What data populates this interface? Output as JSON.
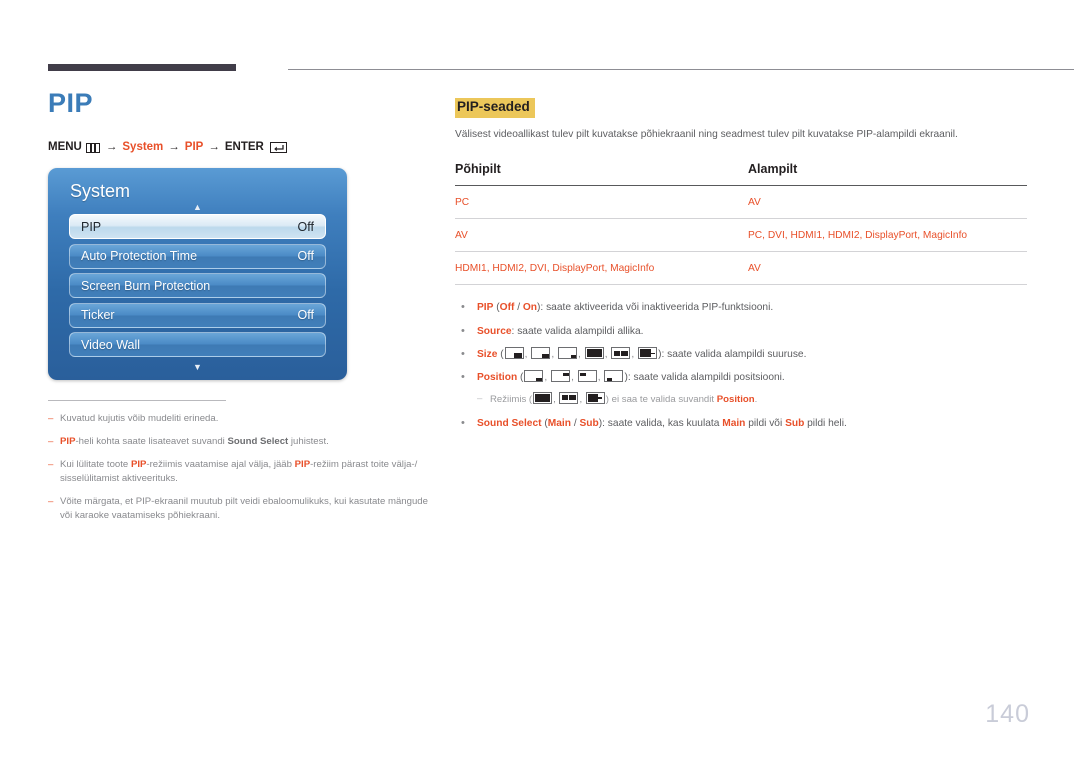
{
  "document": {
    "page_number": "140",
    "language": "et"
  },
  "left": {
    "title": "PIP",
    "menu_path": {
      "menu_label": "MENU",
      "menu_icon": "menu-bars-icon",
      "arrow": "→",
      "system_label": "System",
      "pip_label": "PIP",
      "enter_label": "ENTER",
      "enter_icon": "enter-return-icon"
    },
    "osd": {
      "title": "System",
      "scroll_up_icon": "caret-up-icon",
      "scroll_down_icon": "caret-down-icon",
      "rows": [
        {
          "label": "PIP",
          "value": "Off",
          "selected": true
        },
        {
          "label": "Auto Protection Time",
          "value": "Off",
          "selected": false
        },
        {
          "label": "Screen Burn Protection",
          "value": "",
          "selected": false
        },
        {
          "label": "Ticker",
          "value": "Off",
          "selected": false
        },
        {
          "label": "Video Wall",
          "value": "",
          "selected": false
        }
      ]
    },
    "notes": [
      {
        "dash": "–",
        "html": "Kuvatud kujutis võib mudeliti erineda."
      },
      {
        "dash": "–",
        "html": "<b>PIP</b>-heli kohta saate lisateavet suvandi <span class=\"gray-b\">Sound Select</span> juhistest."
      },
      {
        "dash": "–",
        "html": "Kui lülitate toote <b>PIP</b>-režiimis vaatamise ajal välja, jääb <b>PIP</b>-režiim pärast toite välja-/ sisselülitamist aktiveerituks."
      },
      {
        "dash": "–",
        "html": "Võite märgata, et PIP-ekraanil muutub pilt veidi ebaloomulikuks, kui kasutate mängude või karaoke vaatamiseks põhiekraani."
      }
    ]
  },
  "right": {
    "section_heading": "PIP-seaded",
    "section_description": "Välisest videoallikast tulev pilt kuvatakse põhiekraanil ning seadmest tulev pilt kuvatakse PIP-alampildi ekraanil.",
    "table": {
      "headers": [
        "Põhipilt",
        "Alampilt"
      ],
      "rows": [
        [
          "PC",
          "AV"
        ],
        [
          "AV",
          "PC, DVI, HDMI1, HDMI2, DisplayPort, MagicInfo"
        ],
        [
          "HDMI1, HDMI2, DVI, DisplayPort, MagicInfo",
          "AV"
        ]
      ]
    },
    "bullets": [
      {
        "bullet": "•",
        "html": "<b>PIP</b> (<b>Off</b> / <b>On</b>): saate aktiveerida või inaktiveerida PIP-funktsiooni."
      },
      {
        "bullet": "•",
        "html": "<b>Source</b>: saate valida alampildi allika."
      },
      {
        "bullet": "•",
        "html": "<b>Size</b> (@ICONS_SIZE@): saate valida alampildi suuruse."
      },
      {
        "bullet": "•",
        "html": "<b>Position</b> (@ICONS_POSITION@): saate valida alampildi positsiooni."
      },
      {
        "bullet": "•",
        "html": "<b>Sound Select</b> (<b>Main</b> / <b>Sub</b>): saate valida, kas kuulata <b>Main</b> pildi või <b>Sub</b> pildi heli."
      }
    ],
    "subnote": {
      "dash": "–",
      "html": "Režiimis (@ICONS_SUBNOTE@) ei saa te valida suvandit <b>Position</b>."
    },
    "icon_sets": {
      "size": [
        "pip-size-large-bottom-right-icon",
        "pip-size-medium-bottom-right-icon",
        "pip-size-small-bottom-right-icon",
        "pip-split-half-icon",
        "pip-split-small-icon",
        "pip-split-wide-icon"
      ],
      "position": [
        "pip-position-bottom-right-icon",
        "pip-position-top-right-icon",
        "pip-position-top-left-icon",
        "pip-position-bottom-left-icon"
      ],
      "subnote": [
        "pip-split-half-icon",
        "pip-split-small-icon",
        "pip-split-wide-icon"
      ]
    }
  },
  "colors": {
    "accent_orange": "#e8502a",
    "title_blue": "#3b7cb8",
    "highlight_yellow": "#ecc75a",
    "osd_blue": "#3f7fbe",
    "page_number_gray": "#c9ccd8",
    "rule_dark": "#413d49"
  }
}
